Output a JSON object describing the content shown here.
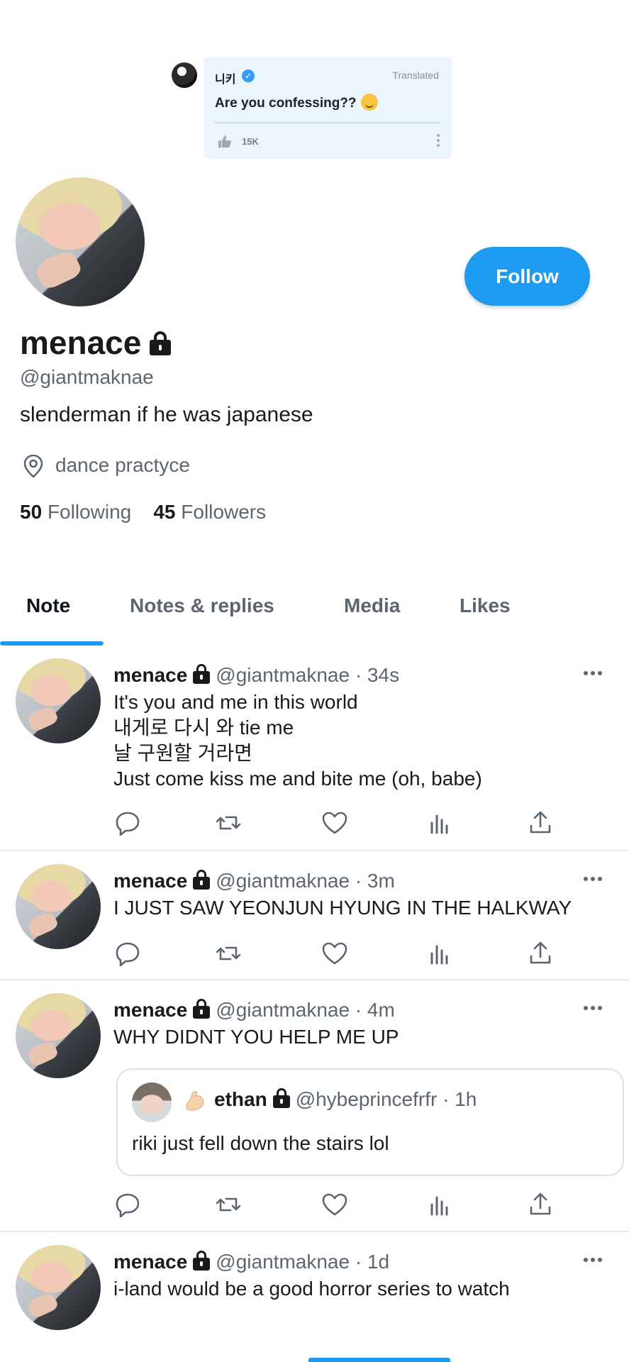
{
  "embed": {
    "name": "니키",
    "translated_label": "Translated",
    "text": "Are you confessing??",
    "likes": "15K"
  },
  "profile": {
    "display_name": "menace",
    "handle": "@giantmaknae",
    "bio": "slenderman if he was japanese",
    "location": "dance practyce",
    "following_count": "50",
    "following_label": "Following",
    "followers_count": "45",
    "followers_label": "Followers",
    "follow_button": "Follow"
  },
  "tabs": [
    {
      "label": "Note"
    },
    {
      "label": "Notes & replies"
    },
    {
      "label": "Media"
    },
    {
      "label": "Likes"
    }
  ],
  "posts": [
    {
      "name": "menace",
      "meta": "@giantmaknae · 34s",
      "lines": [
        "It's you and me in this world",
        "내게로 다시 와 tie me",
        "날 구원할 거라면",
        "Just come kiss me and bite me (oh, babe)"
      ]
    },
    {
      "name": "menace",
      "meta": "@giantmaknae · 3m",
      "lines": [
        "I JUST SAW YEONJUN HYUNG IN THE HALKWAY"
      ]
    },
    {
      "name": "menace",
      "meta": "@giantmaknae · 4m",
      "lines": [
        "WHY DIDNT YOU HELP ME UP"
      ],
      "quote": {
        "name": "ethan",
        "meta": "@hybeprincefrfr · 1h",
        "text": "riki just fell down the stairs lol"
      }
    },
    {
      "name": "menace",
      "meta": "@giantmaknae · 1d",
      "lines": [
        "i-land would be a good horror series to watch"
      ]
    }
  ],
  "colors": {
    "accent": "#1d9bf0",
    "text_secondary": "#5b6670",
    "embed_bg": "#eaf6fc"
  },
  "icons": [
    "reply-icon",
    "retweet-icon",
    "like-icon",
    "analytics-icon",
    "share-icon",
    "more-icon",
    "lock-icon",
    "location-icon",
    "thumbs-up-icon",
    "verified-icon",
    "flexed-biceps-emoji",
    "smirk-emoji"
  ]
}
